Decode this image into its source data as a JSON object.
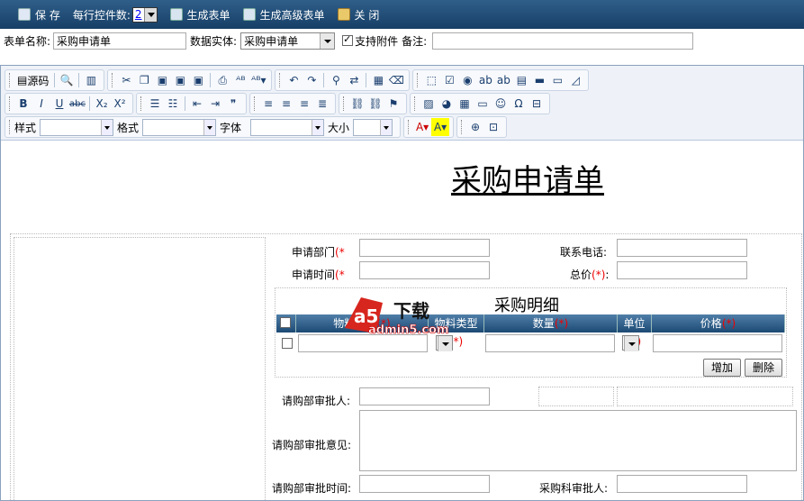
{
  "topbar": {
    "save": "保 存",
    "rows_label": "每行控件数:",
    "rows_value": "2",
    "gen": "生成表单",
    "gen_adv": "生成高级表单",
    "close": "关 闭"
  },
  "form": {
    "name_label": "表单名称:",
    "name_value": "采购申请单",
    "entity_label": "数据实体:",
    "entity_value": "采购申请单",
    "attach_label": "支持附件",
    "note_label": "备注:"
  },
  "toolbar": {
    "source": "源码",
    "style_label": "样式",
    "format_label": "格式",
    "font_label": "字体",
    "size_label": "大小"
  },
  "doc": {
    "title": "采购申请单",
    "f1": "申请部门",
    "f2": "联系电话:",
    "f3": "申请时间",
    "f4": "总价",
    "req": "(*)",
    "req_open": "(*",
    "detail_title": "采购明细",
    "cols": [
      "物料名称",
      "物料类型",
      "数量",
      "单位",
      "价格"
    ],
    "add": "增加",
    "del": "删除",
    "a1": "请购部审批人:",
    "a2": "请购部审批意见:",
    "a3": "请购部审批时间:",
    "a4": "采购科审批人:",
    "colon": ":"
  },
  "logo": {
    "a5": "a5",
    "dl": "下载",
    "site": "admin5.com"
  }
}
